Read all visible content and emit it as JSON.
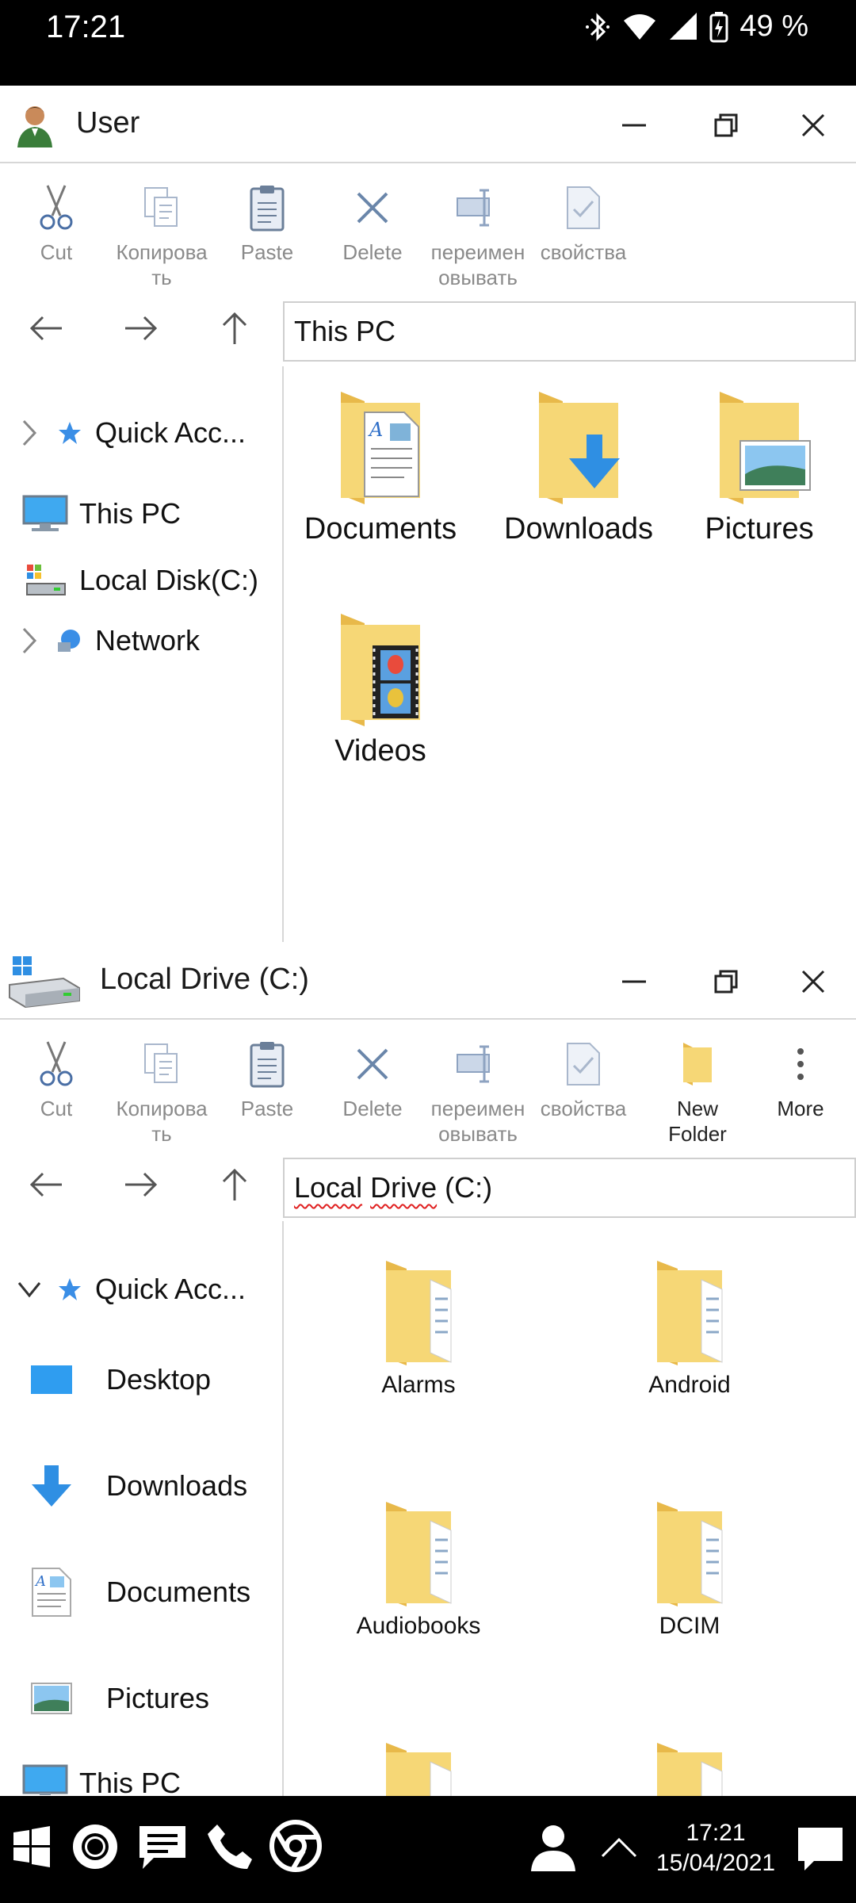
{
  "status_bar": {
    "time": "17:21",
    "battery": "49 %"
  },
  "toolbar_common": {
    "cut": "Cut",
    "copy": "Копирова ть",
    "paste": "Paste",
    "delete": "Delete",
    "rename": "переимен овывать",
    "properties": "свойства"
  },
  "window1": {
    "title": "User",
    "address": "This PC",
    "sidebar": [
      {
        "label": "Quick Acc..."
      },
      {
        "label": "This PC"
      },
      {
        "label": "Local Disk(C:)"
      },
      {
        "label": "Network"
      }
    ],
    "items": [
      {
        "label": "Documents"
      },
      {
        "label": "Downloads"
      },
      {
        "label": "Pictures"
      },
      {
        "label": "Videos"
      }
    ]
  },
  "window2": {
    "title": "Local Drive (C:)",
    "address_words": [
      "Local",
      "Drive",
      "(C:)"
    ],
    "toolbar_extra": {
      "new_folder": "New Folder",
      "more": "More"
    },
    "sidebar": [
      {
        "label": "Quick Acc..."
      },
      {
        "label": "Desktop"
      },
      {
        "label": "Downloads"
      },
      {
        "label": "Documents"
      },
      {
        "label": "Pictures"
      },
      {
        "label": "This PC"
      }
    ],
    "items": [
      {
        "label": "Alarms"
      },
      {
        "label": "Android"
      },
      {
        "label": "Audiobooks"
      },
      {
        "label": "DCIM"
      }
    ]
  },
  "taskbar": {
    "time": "17:21",
    "date": "15/04/2021"
  },
  "colors": {
    "folder": "#f6d776",
    "folder_dark": "#e8b94a",
    "accent_blue": "#2f8fe3"
  }
}
